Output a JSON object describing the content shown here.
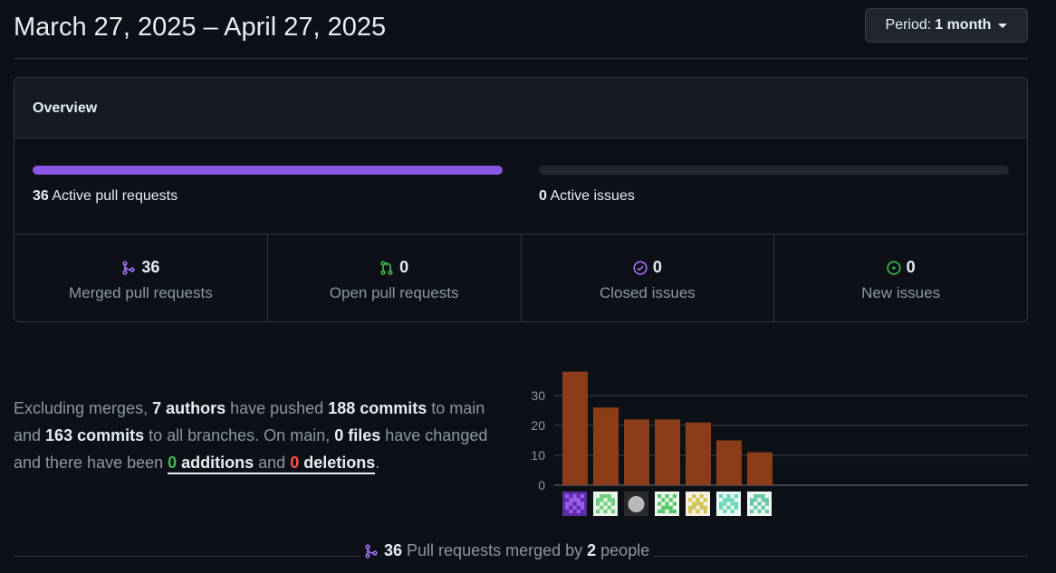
{
  "header": {
    "title": "March 27, 2025 – April 27, 2025",
    "period_prefix": "Period:",
    "period_value": "1 month"
  },
  "overview": {
    "heading": "Overview",
    "pull_requests": {
      "count": "36",
      "label": "Active pull requests",
      "fill_fraction": 1.0,
      "color": "#8957e5"
    },
    "issues": {
      "count": "0",
      "label": "Active issues",
      "fill_fraction": 0.0
    },
    "stats": [
      {
        "value": "36",
        "label": "Merged pull requests",
        "icon": "merged-pr-icon",
        "color": "#a371f7"
      },
      {
        "value": "0",
        "label": "Open pull requests",
        "icon": "open-pr-icon",
        "color": "#3fb950"
      },
      {
        "value": "0",
        "label": "Closed issues",
        "icon": "closed-issue-icon",
        "color": "#a371f7"
      },
      {
        "value": "0",
        "label": "New issues",
        "icon": "open-issue-icon",
        "color": "#3fb950"
      }
    ]
  },
  "summary": {
    "t1": "Excluding merges, ",
    "authors": "7 authors",
    "t2": " have pushed ",
    "commits_main": "188 commits",
    "t3": " to main and ",
    "commits_all": "163 commits",
    "t4": " to all branches. On main, ",
    "files": "0 files",
    "t5": " have changed and there have been ",
    "add_num": "0",
    "add_word": " additions",
    "t6": " and ",
    "del_num": "0",
    "del_word": " deletions",
    "t7": "."
  },
  "chart_data": {
    "type": "bar",
    "values": [
      38,
      26,
      22,
      22,
      21,
      15,
      11
    ],
    "yticks": [
      0,
      10,
      20,
      30
    ],
    "ylim": [
      0,
      38
    ],
    "bar_color": "#8b3d1a",
    "avatars": [
      "avatar-1",
      "avatar-2",
      "avatar-3",
      "avatar-4",
      "avatar-5",
      "avatar-6",
      "avatar-7"
    ]
  },
  "footer": {
    "pr_count": "36",
    "t1": " Pull requests merged by ",
    "people": "2",
    "t2": " people"
  }
}
